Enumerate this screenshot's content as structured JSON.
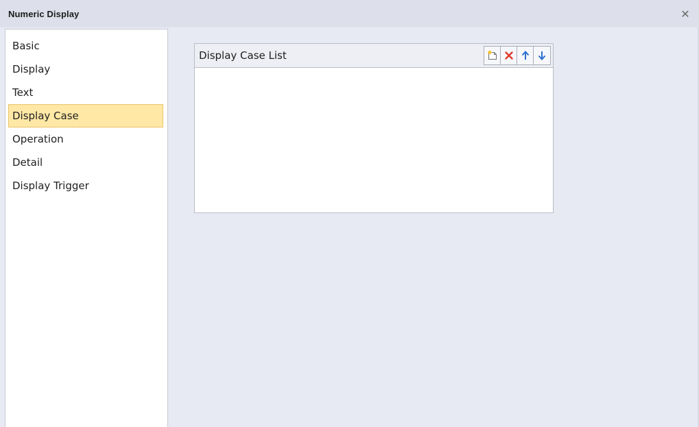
{
  "window": {
    "title": "Numeric Display",
    "close_icon": "close-icon"
  },
  "sidebar": {
    "items": [
      {
        "label": "Basic",
        "selected": false
      },
      {
        "label": "Display",
        "selected": false
      },
      {
        "label": "Text",
        "selected": false
      },
      {
        "label": "Display Case",
        "selected": true
      },
      {
        "label": "Operation",
        "selected": false
      },
      {
        "label": "Detail",
        "selected": false
      },
      {
        "label": "Display Trigger",
        "selected": false
      }
    ]
  },
  "display_case_list": {
    "title": "Display Case List",
    "buttons": [
      {
        "icon": "new-item-icon"
      },
      {
        "icon": "delete-icon",
        "color": "#e03a2a"
      },
      {
        "icon": "arrow-up-icon",
        "color": "#2a6fd0"
      },
      {
        "icon": "arrow-down-icon",
        "color": "#2a6fd0"
      }
    ],
    "items": []
  },
  "colors": {
    "selected_bg": "#ffe8a6",
    "selected_border": "#e9c46a",
    "window_bg": "#e8eaf3",
    "titlebar_bg": "#dde0ea"
  }
}
